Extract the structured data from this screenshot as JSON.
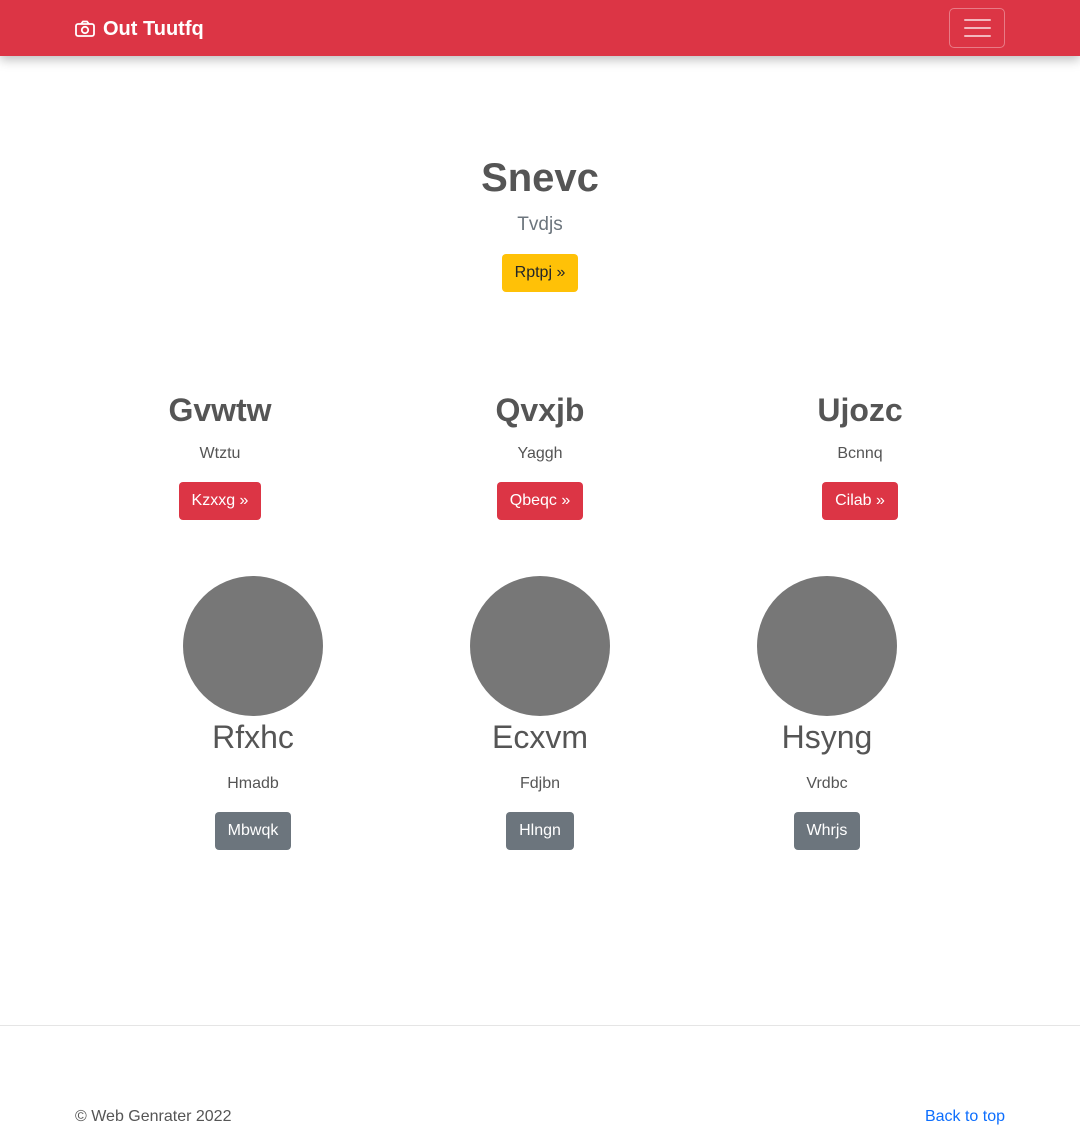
{
  "navbar": {
    "brand": "Out Tuutfq",
    "brand_icon": "camera-icon",
    "toggler_icon": "hamburger-menu-icon",
    "color": "#dc3545"
  },
  "hero": {
    "title": "Snevc",
    "subtitle": "Tvdjs",
    "button": "Rptpj »"
  },
  "features": [
    {
      "title": "Gvwtw",
      "text": "Wtztu",
      "button": "Kzxxg »"
    },
    {
      "title": "Qvxjb",
      "text": "Yaggh",
      "button": "Qbeqc »"
    },
    {
      "title": "Ujozc",
      "text": "Bcnnq",
      "button": "Cilab »"
    }
  ],
  "people": [
    {
      "name": "Rfxhc",
      "text": "Hmadb",
      "button": "Mbwqk"
    },
    {
      "name": "Ecxvm",
      "text": "Fdjbn",
      "button": "Hlngn"
    },
    {
      "name": "Hsyng",
      "text": "Vrdbc",
      "button": "Whrjs"
    }
  ],
  "footer": {
    "copyright": "© Web Genrater 2022",
    "back_to_top": "Back to top"
  },
  "colors": {
    "primary": "#dc3545",
    "warning": "#ffc107",
    "secondary": "#6c757d",
    "link": "#0d6efd",
    "avatar": "#777777"
  }
}
